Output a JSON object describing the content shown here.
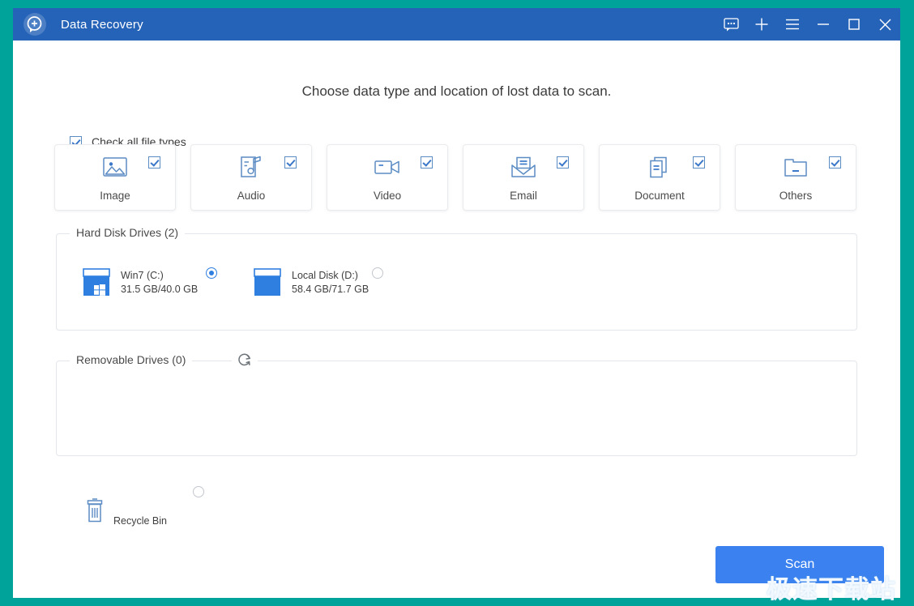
{
  "window": {
    "title": "Data Recovery",
    "logo_icon": "magnifier-plus-icon",
    "frame_color": "#00a39a",
    "titlebar_color": "#2563b8"
  },
  "titlebar_buttons": [
    {
      "name": "feedback-button",
      "icon": "chat-bubble-icon"
    },
    {
      "name": "add-button",
      "icon": "plus-icon"
    },
    {
      "name": "menu-button",
      "icon": "hamburger-menu-icon"
    },
    {
      "name": "minimize-button",
      "icon": "minimize-icon"
    },
    {
      "name": "maximize-button",
      "icon": "maximize-icon"
    },
    {
      "name": "close-button",
      "icon": "close-icon"
    }
  ],
  "main": {
    "heading": "Choose data type and location of lost data to scan.",
    "check_all": {
      "label": "Check all file types",
      "checked": true
    },
    "file_types": [
      {
        "label": "Image",
        "icon": "image-icon",
        "checked": true
      },
      {
        "label": "Audio",
        "icon": "audio-icon",
        "checked": true
      },
      {
        "label": "Video",
        "icon": "video-icon",
        "checked": true
      },
      {
        "label": "Email",
        "icon": "email-icon",
        "checked": true
      },
      {
        "label": "Document",
        "icon": "document-icon",
        "checked": true
      },
      {
        "label": "Others",
        "icon": "folder-icon",
        "checked": true
      }
    ],
    "hard_disk_drives": {
      "legend": "Hard Disk Drives (2)",
      "drives": [
        {
          "name": "Win7 (C:)",
          "size": "31.5 GB/40.0 GB",
          "icon": "windows-drive-icon",
          "selected": true
        },
        {
          "name": "Local Disk (D:)",
          "size": "58.4 GB/71.7 GB",
          "icon": "drive-icon",
          "selected": false
        }
      ]
    },
    "removable_drives": {
      "legend": "Removable Drives (0)",
      "refresh_icon": "refresh-icon",
      "drives": []
    },
    "recycle_bin": {
      "label": "Recycle Bin",
      "icon": "trash-icon",
      "selected": false
    },
    "scan_button": {
      "label": "Scan",
      "color": "#3b82f0"
    }
  },
  "watermark": {
    "text": "极速下载站"
  }
}
